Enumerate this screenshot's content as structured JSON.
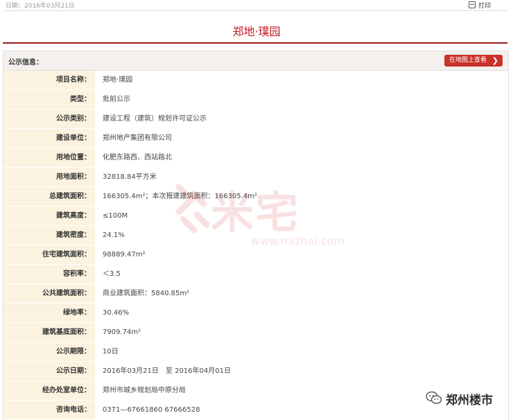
{
  "topbar": {
    "date": "日期：2016年03月21日",
    "print_label": "打印"
  },
  "page_title": "郑地·璞园",
  "section": {
    "label": "公示信息：",
    "map_button": "在地图上查看"
  },
  "fields": [
    {
      "key": "项目名称：",
      "value": "郑地·璞园"
    },
    {
      "key": "类型：",
      "value": "批前公示"
    },
    {
      "key": "公示类别：",
      "value": "建设工程（建筑）规划许可证公示"
    },
    {
      "key": "建设单位：",
      "value": "郑州地产集团有限公司"
    },
    {
      "key": "用地位置：",
      "value": "化肥东路西、西站路北"
    },
    {
      "key": "用地面积：",
      "value": "32818.84平方米"
    },
    {
      "key": "总建筑面积：",
      "value": "166305.4m²；本次报建建筑面积：166305.4m²"
    },
    {
      "key": "建筑高度：",
      "value": "≤100M"
    },
    {
      "key": "建筑密度：",
      "value": "24.1%"
    },
    {
      "key": "住宅建筑面积：",
      "value": "98889.47m²"
    },
    {
      "key": "容积率：",
      "value": "＜3.5"
    },
    {
      "key": "公共建筑面积：",
      "value": "商业建筑面积：5840.85m²"
    },
    {
      "key": "绿地率：",
      "value": "30.46%"
    },
    {
      "key": "建筑基底面积：",
      "value": "7909.74m²"
    },
    {
      "key": "公示期限：",
      "value": "10日"
    },
    {
      "key": "公示日期：",
      "value": "2016年03月21日　至 2016年04月01日"
    },
    {
      "key": "经办处室单位：",
      "value": "郑州市城乡规划局中原分局"
    },
    {
      "key": "咨询电话：",
      "value": "0371—67661860 67666528"
    }
  ],
  "watermark": {
    "text": "米宅",
    "url": "www.mizhai.com"
  },
  "brand": {
    "name": "郑州楼市",
    "icon": "wechat-icon"
  },
  "colors": {
    "title_red": "#c0181e",
    "button_red": "#c9322a",
    "key_bg": "#fbf3e0",
    "divider_red": "#9b1b1b"
  }
}
